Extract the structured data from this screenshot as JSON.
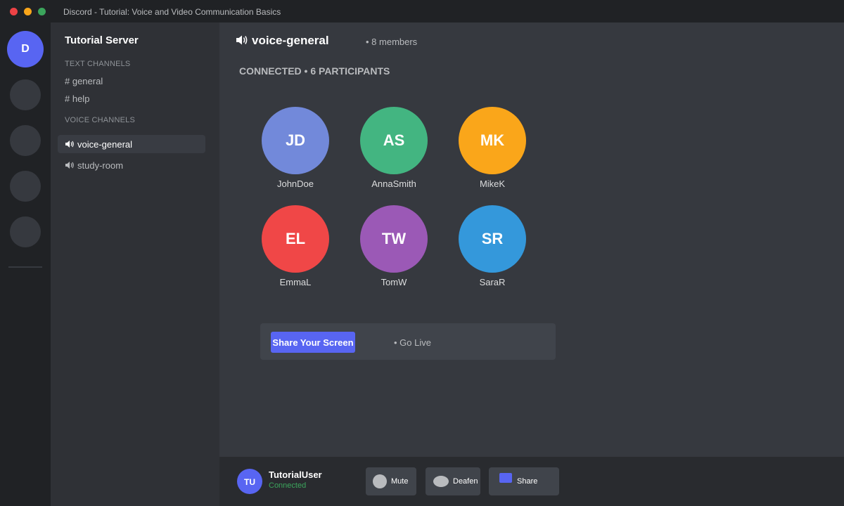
{
  "window": {
    "title": "Discord - Tutorial: Voice and Video Communication Basics"
  },
  "server_rail": {
    "home_initial": "D"
  },
  "sidebar": {
    "server_name": "Tutorial Server",
    "text_section_label": "TEXT CHANNELS",
    "text_channels": [
      "# general",
      "# help"
    ],
    "voice_section_label": "VOICE CHANNELS",
    "voice_channels": [
      {
        "label": "voice-general",
        "active": true
      },
      {
        "label": "study-room",
        "active": false
      }
    ]
  },
  "main": {
    "channel_title": "voice-general",
    "member_count": "• 8 members",
    "connected_status": "CONNECTED • 6 PARTICIPANTS",
    "participants": [
      {
        "initials": "JD",
        "name": "JohnDoe",
        "color": "#7289da"
      },
      {
        "initials": "AS",
        "name": "AnnaSmith",
        "color": "#43b581"
      },
      {
        "initials": "MK",
        "name": "MikeK",
        "color": "#faa61a"
      },
      {
        "initials": "EL",
        "name": "EmmaL",
        "color": "#f04747"
      },
      {
        "initials": "TW",
        "name": "TomW",
        "color": "#9b59b6"
      },
      {
        "initials": "SR",
        "name": "SaraR",
        "color": "#3498db"
      }
    ],
    "share_panel": {
      "button_label": "Share Your Screen",
      "go_live_label": "• Go Live"
    }
  },
  "user_bar": {
    "avatar_initials": "TU",
    "username": "TutorialUser",
    "status": "Connected",
    "mute_label": "Mute",
    "deafen_label": "Deafen",
    "share_label": "Share"
  },
  "colors": {
    "accent": "#5865f2",
    "connected_green": "#3ba55c"
  }
}
